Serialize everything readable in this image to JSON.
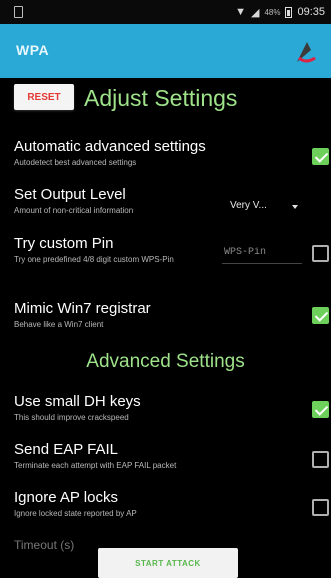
{
  "status_bar": {
    "time": "09:35",
    "battery": "48%"
  },
  "app_bar": {
    "title": "WPA",
    "logo_icon": "anchor-logo-icon"
  },
  "main": {
    "reset_label": "RESET",
    "section_title": "Adjust Settings",
    "advanced_title": "Advanced Settings",
    "settings": [
      {
        "title": "Automatic advanced settings",
        "summary": "Autodetect best advanced settings",
        "checked": true
      },
      {
        "title": "Set Output Level",
        "summary": "Amount of non-critical information",
        "value": "Very V...",
        "control": "spinner"
      },
      {
        "title": "Try custom Pin",
        "summary": "Try one predefined 4/8 digit custom WPS-Pin",
        "placeholder": "WPS-Pin",
        "checked": false
      },
      {
        "title": "Mimic Win7 registrar",
        "summary": "Behave like a Win7 client",
        "checked": true
      },
      {
        "title": "Use small DH keys",
        "summary": "This should improve crackspeed",
        "checked": true
      },
      {
        "title": "Send EAP FAIL",
        "summary": "Terminate each attempt with EAP FAIL packet",
        "checked": false
      },
      {
        "title": "Ignore AP locks",
        "summary": "Ignore locked state reported by AP",
        "checked": false
      }
    ],
    "partial_title": "Timeout (s)",
    "start_label": "START ATTACK"
  },
  "colors": {
    "app_bar": "#2aa9d6",
    "accent_green": "#9ee28a",
    "checkbox_green": "#6cd05a",
    "reset_red": "#e53935"
  }
}
